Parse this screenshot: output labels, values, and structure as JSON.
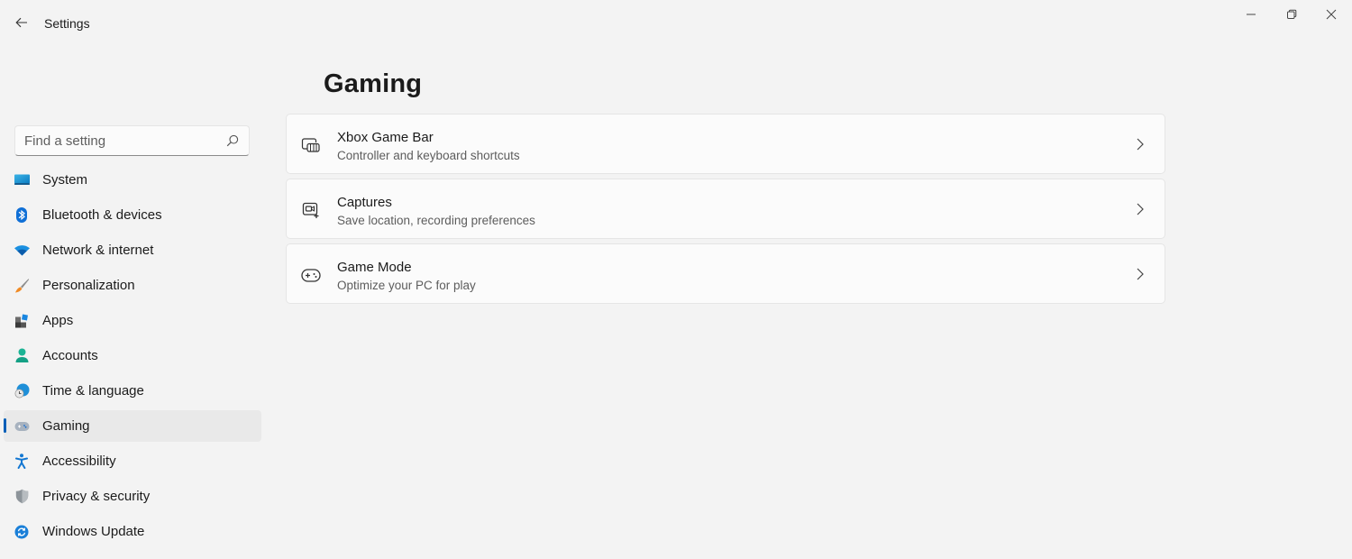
{
  "window": {
    "title": "Settings",
    "controls": {
      "minimize": "minimize",
      "maximize": "restore",
      "close": "close"
    }
  },
  "search": {
    "placeholder": "Find a setting",
    "value": ""
  },
  "sidebar": {
    "selected": "Gaming",
    "items": [
      {
        "label": "System",
        "icon": "system-icon"
      },
      {
        "label": "Bluetooth & devices",
        "icon": "bluetooth-icon"
      },
      {
        "label": "Network & internet",
        "icon": "wifi-icon"
      },
      {
        "label": "Personalization",
        "icon": "brush-icon"
      },
      {
        "label": "Apps",
        "icon": "apps-icon"
      },
      {
        "label": "Accounts",
        "icon": "account-icon"
      },
      {
        "label": "Time & language",
        "icon": "time-language-icon"
      },
      {
        "label": "Gaming",
        "icon": "gamepad-icon"
      },
      {
        "label": "Accessibility",
        "icon": "accessibility-icon"
      },
      {
        "label": "Privacy & security",
        "icon": "shield-icon"
      },
      {
        "label": "Windows Update",
        "icon": "update-icon"
      }
    ]
  },
  "main": {
    "title": "Gaming",
    "cards": [
      {
        "title": "Xbox Game Bar",
        "subtitle": "Controller and keyboard shortcuts",
        "icon": "game-bar-icon"
      },
      {
        "title": "Captures",
        "subtitle": "Save location, recording preferences",
        "icon": "captures-icon"
      },
      {
        "title": "Game Mode",
        "subtitle": "Optimize your PC for play",
        "icon": "game-mode-icon"
      }
    ]
  },
  "colors": {
    "accent": "#005fb8",
    "background": "#f3f3f3",
    "card": "#fbfbfb",
    "selected": "#e9e9e9"
  }
}
